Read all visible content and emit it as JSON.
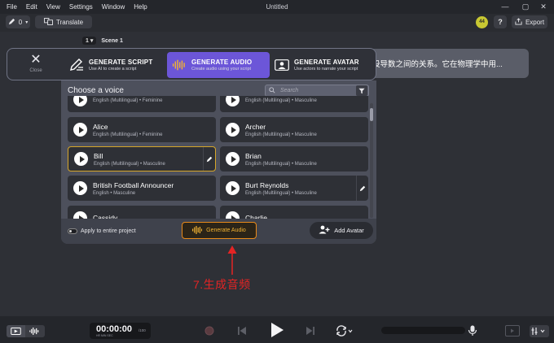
{
  "menubar": {
    "items": [
      "File",
      "Edit",
      "View",
      "Settings",
      "Window",
      "Help"
    ],
    "title": "Untitled",
    "controls": [
      "—",
      "▢",
      "✕"
    ]
  },
  "toolbar": {
    "edit_count": "0",
    "translate_label": "Translate",
    "badge": "44",
    "help_label": "?",
    "export_label": "Export"
  },
  "scene": {
    "number": "1",
    "label": "Scene 1"
  },
  "script_banner": {
    "text": "设导数之间的关系。它在物理学中用..."
  },
  "mode_panel": {
    "close_label": "Close",
    "options": [
      {
        "title": "GENERATE SCRIPT",
        "subtitle": "Use AI to create a script",
        "icon": "pencil-script-icon",
        "active": false
      },
      {
        "title": "GENERATE AUDIO",
        "subtitle": "Create audio using your script",
        "icon": "waveform-icon",
        "active": true
      },
      {
        "title": "GENERATE AVATAR",
        "subtitle": "Use actors to narrate your script",
        "icon": "avatar-card-icon",
        "active": false
      }
    ]
  },
  "voice_panel": {
    "header": "Choose a voice",
    "search_placeholder": "Search",
    "voices": [
      {
        "name": "",
        "desc": "English (Multilingual) • Feminine",
        "selected": false,
        "editable": false
      },
      {
        "name": "",
        "desc": "English (Multilingual) • Masculine",
        "selected": false,
        "editable": false
      },
      {
        "name": "Alice",
        "desc": "English (Multilingual) • Feminine",
        "selected": false,
        "editable": false
      },
      {
        "name": "Archer",
        "desc": "English (Multilingual) • Masculine",
        "selected": false,
        "editable": false
      },
      {
        "name": "Bill",
        "desc": "English (Multilingual) • Masculine",
        "selected": true,
        "editable": true
      },
      {
        "name": "Brian",
        "desc": "English (Multilingual) • Masculine",
        "selected": false,
        "editable": false
      },
      {
        "name": "British Football Announcer",
        "desc": "English • Masculine",
        "selected": false,
        "editable": false
      },
      {
        "name": "Burt Reynolds",
        "desc": "English (Multilingual) • Masculine",
        "selected": false,
        "editable": true
      },
      {
        "name": "Cassidy",
        "desc": "",
        "selected": false,
        "editable": false
      },
      {
        "name": "Charlie",
        "desc": "",
        "selected": false,
        "editable": false
      }
    ],
    "apply_label": "Apply to entire project",
    "apply_checked": false,
    "generate_label": "Generate Audio",
    "add_avatar_label": "Add Avatar"
  },
  "annotation": {
    "text": "7.生成音频",
    "color": "#e42424"
  },
  "transport": {
    "timecode": "00:00:00",
    "units": "HR    MIN    SEC",
    "frames": "/100"
  },
  "colors": {
    "accent": "#6c56d8",
    "highlight": "#e88a1a",
    "selected_border": "#d6a629"
  }
}
